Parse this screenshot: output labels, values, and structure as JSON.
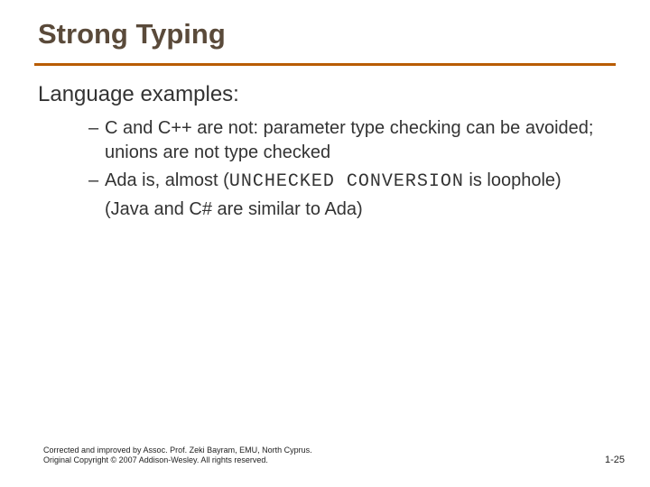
{
  "slide": {
    "title": "Strong Typing",
    "subhead": "Language examples:",
    "bullets": [
      {
        "pre": "C and C++ are not: parameter type checking can be avoided; unions are not type checked",
        "mono": "",
        "post": ""
      },
      {
        "pre": "Ada is, almost (",
        "mono": "UNCHECKED CONVERSION",
        "post": " is loophole)"
      },
      {
        "pre": "(Java and C# are similar to Ada)",
        "mono": "",
        "post": "",
        "nobullet": true
      }
    ],
    "footer_left": "Corrected and improved by Assoc. Prof. Zeki Bayram, EMU, North Cyprus. Original Copyright © 2007 Addison-Wesley. All rights reserved.",
    "footer_right": "1-25"
  }
}
